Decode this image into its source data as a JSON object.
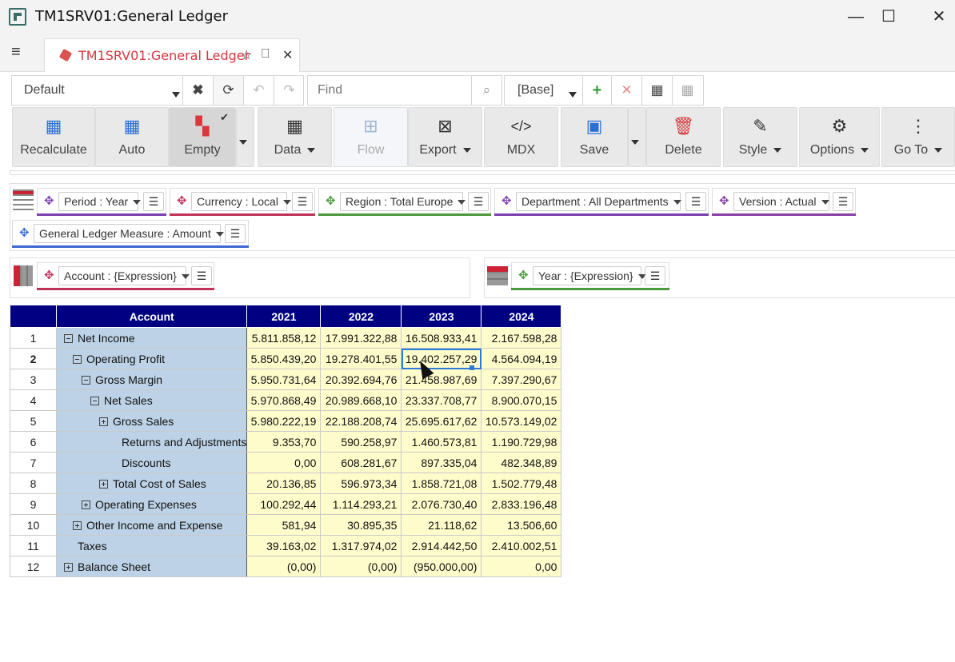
{
  "window": {
    "title": "TM1SRV01:General Ledger",
    "minimize": "—",
    "maximize": "☐",
    "close": "✕"
  },
  "tab": {
    "label": "TM1SRV01:General Ledger",
    "close": "✕"
  },
  "toolbar": {
    "view_select": "Default",
    "find_placeholder": "Find",
    "base_select": "[Base]"
  },
  "ribbon": {
    "recalculate": "Recalculate",
    "auto": "Auto",
    "empty": "Empty",
    "data": "Data",
    "flow": "Flow",
    "export": "Export",
    "mdx": "MDX",
    "save": "Save",
    "delete": "Delete",
    "style": "Style",
    "options": "Options",
    "goto": "Go To"
  },
  "context": [
    {
      "label": "Period : Year",
      "color": "#7a3fb0"
    },
    {
      "label": "Currency : Local",
      "color": "#c0325a"
    },
    {
      "label": "Region : Total Europe",
      "color": "#4a9a3a"
    },
    {
      "label": "Department : All Departments",
      "color": "#7a3fb0"
    },
    {
      "label": "Version : Actual",
      "color": "#8a3fa8"
    },
    {
      "label": "General Ledger Measure : Amount",
      "color": "#3a6ad0"
    }
  ],
  "rows_dim": {
    "label": "Account : {Expression}",
    "color": "#c0325a"
  },
  "cols_dim": {
    "label": "Year : {Expression}",
    "color": "#4a9a3a"
  },
  "grid": {
    "header_account": "Account",
    "years": [
      "2021",
      "2022",
      "2023",
      "2024"
    ],
    "rows": [
      {
        "n": "1",
        "name": "Net Income",
        "values": [
          "5.811.858,12",
          "17.991.322,88",
          "16.508.933,41",
          "2.167.598,28"
        ]
      },
      {
        "n": "2",
        "name": "Operating Profit",
        "values": [
          "5.850.439,20",
          "19.278.401,55",
          "19.402.257,29",
          "4.564.094,19"
        ]
      },
      {
        "n": "3",
        "name": "Gross Margin",
        "values": [
          "5.950.731,64",
          "20.392.694,76",
          "21.458.987,69",
          "7.397.290,67"
        ]
      },
      {
        "n": "4",
        "name": "Net Sales",
        "values": [
          "5.970.868,49",
          "20.989.668,10",
          "23.337.708,77",
          "8.900.070,15"
        ]
      },
      {
        "n": "5",
        "name": "Gross Sales",
        "values": [
          "5.980.222,19",
          "22.188.208,74",
          "25.695.617,62",
          "10.573.149,02"
        ]
      },
      {
        "n": "6",
        "name": "Returns and Adjustments",
        "values": [
          "9.353,70",
          "590.258,97",
          "1.460.573,81",
          "1.190.729,98"
        ]
      },
      {
        "n": "7",
        "name": "Discounts",
        "values": [
          "0,00",
          "608.281,67",
          "897.335,04",
          "482.348,89"
        ]
      },
      {
        "n": "8",
        "name": "Total Cost of Sales",
        "values": [
          "20.136,85",
          "596.973,34",
          "1.858.721,08",
          "1.502.779,48"
        ]
      },
      {
        "n": "9",
        "name": "Operating Expenses",
        "values": [
          "100.292,44",
          "1.114.293,21",
          "2.076.730,40",
          "2.833.196,48"
        ]
      },
      {
        "n": "10",
        "name": "Other Income and Expense",
        "values": [
          "581,94",
          "30.895,35",
          "21.118,62",
          "13.506,60"
        ]
      },
      {
        "n": "11",
        "name": "Taxes",
        "values": [
          "39.163,02",
          "1.317.974,02",
          "2.914.442,50",
          "2.410.002,51"
        ]
      },
      {
        "n": "12",
        "name": "Balance Sheet",
        "values": [
          "(0,00)",
          "(0,00)",
          "(950.000,00)",
          "0,00"
        ]
      }
    ]
  }
}
